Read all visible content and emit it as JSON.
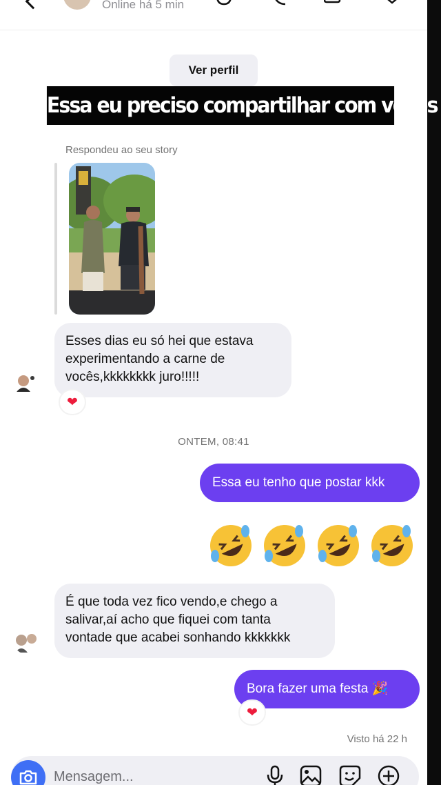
{
  "header": {
    "status": "Online há 5 min",
    "profile_button": "Ver perfil"
  },
  "caption": "Essa eu preciso compartilhar com vocês rs",
  "story_reply": {
    "label": "Respondeu ao seu story"
  },
  "messages": [
    {
      "side": "in",
      "lines": [
        "Esses dias eu só hei que estava",
        "experimentando a carne de",
        "vocês,kkkkkkkk juro!!!!!"
      ],
      "reaction": "❤"
    },
    {
      "type": "timestamp",
      "text": "ONTEM, 08:41"
    },
    {
      "side": "out",
      "text": "Essa eu tenho que postar kkk"
    },
    {
      "side": "out",
      "type": "emoji",
      "emoji": [
        "rolling-on-floor-laughing",
        "rolling-on-floor-laughing",
        "rolling-on-floor-laughing",
        "rolling-on-floor-laughing"
      ]
    },
    {
      "side": "in",
      "lines": [
        "É que toda vez fico vendo,e chego a",
        "salivar,aí acho que fiquei com tanta",
        "vontade que acabei sonhando kkkkkkk"
      ]
    },
    {
      "side": "out",
      "text": "Bora fazer uma festa 🎉",
      "reaction": "❤"
    }
  ],
  "seen_status": "Visto há 22 h",
  "composer": {
    "placeholder": "Mensagem...",
    "icons": [
      "camera-icon",
      "microphone-icon",
      "image-icon",
      "sticker-icon",
      "plus-icon"
    ]
  },
  "colors": {
    "outgoing_bubble": "#6c3ff0",
    "incoming_bubble": "#efeff4",
    "camera_button": "#3f6ff5",
    "heart": "#ed1c3c"
  }
}
